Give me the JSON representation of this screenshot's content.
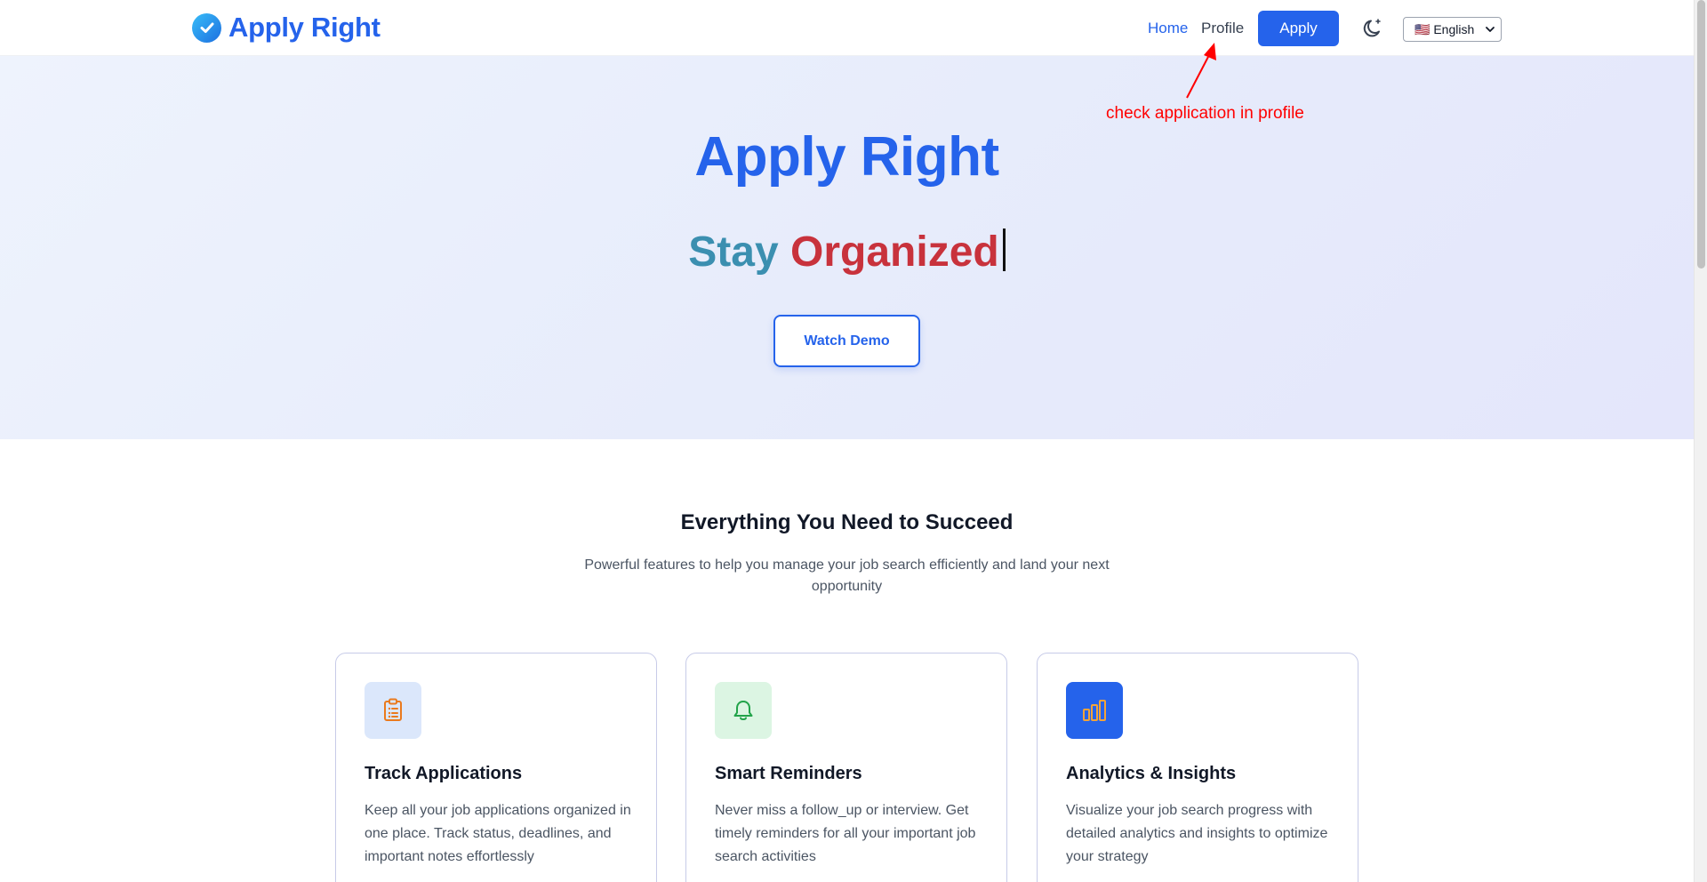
{
  "header": {
    "logo_text": "Apply Right",
    "logo_icon": "check-circle-icon",
    "nav": {
      "home": "Home",
      "profile": "Profile",
      "apply": "Apply"
    },
    "theme_icon": "moon-icon",
    "language": {
      "selected": "🇺🇸 English"
    }
  },
  "annotation": {
    "text": "check application in profile",
    "color": "#ff0000"
  },
  "hero": {
    "title": "Apply Right",
    "subtitle_word1": "Stay",
    "subtitle_word2": "Organized",
    "demo_button": "Watch Demo"
  },
  "features": {
    "title": "Everything You Need to Succeed",
    "description": "Powerful features to help you manage your job search efficiently and land your next opportunity",
    "cards": [
      {
        "title": "Track Applications",
        "text": "Keep all your job applications organized in one place. Track status, deadlines, and important notes effortlessly",
        "icon": "clipboard-list-icon"
      },
      {
        "title": "Smart Reminders",
        "text": "Never miss a follow_up or interview. Get timely reminders for all your important job search activities",
        "icon": "bell-icon"
      },
      {
        "title": "Analytics & Insights",
        "text": "Visualize your job search progress with detailed analytics and insights to optimize your strategy",
        "icon": "bar-chart-icon"
      }
    ]
  },
  "colors": {
    "brand_blue": "#2563eb",
    "stay_teal": "#3b8fb0",
    "organized_red": "#c8323c"
  }
}
